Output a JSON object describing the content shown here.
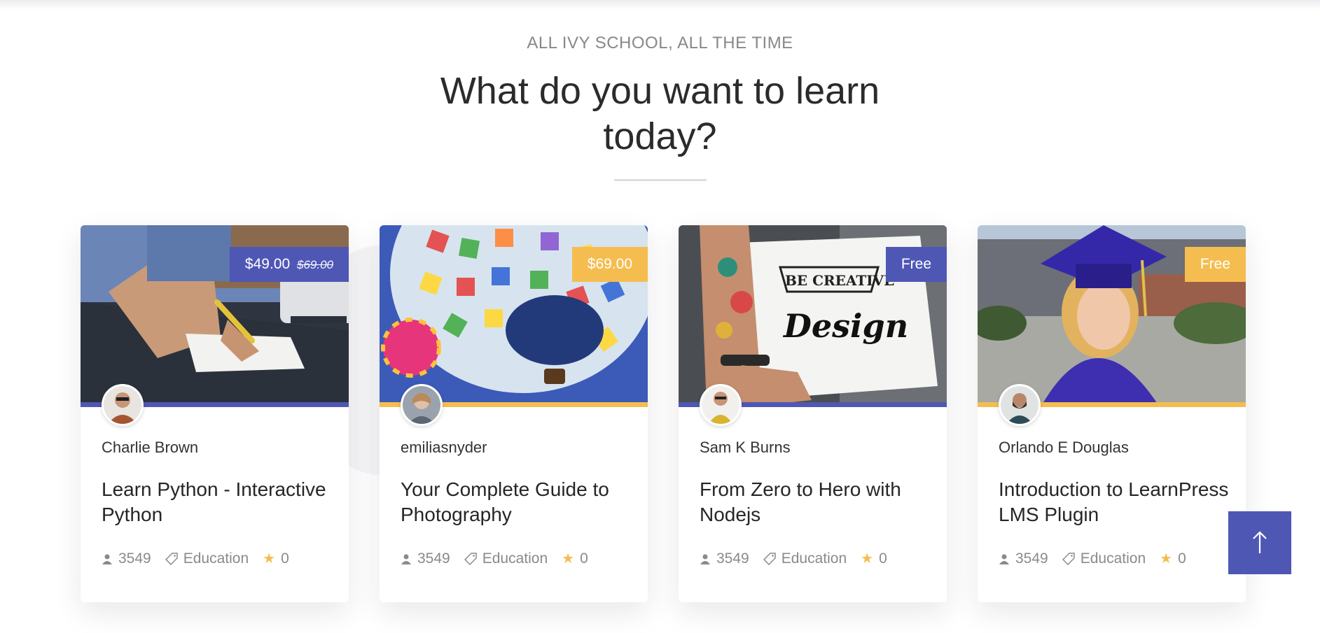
{
  "header": {
    "subtitle": "ALL IVY SCHOOL, ALL THE TIME",
    "title": "What do you want to learn today?"
  },
  "colors": {
    "primary": "#4f57b5",
    "accent": "#f5bd4f"
  },
  "courses": [
    {
      "price": "$49.00",
      "old_price": "$69.00",
      "price_color": "#4f57b5",
      "stripe_color": "#4f57b5",
      "author": "Charlie Brown",
      "title": "Learn Python - Interactive Python",
      "students": "3549",
      "category": "Education",
      "rating": "0"
    },
    {
      "price": "$69.00",
      "old_price": "",
      "price_color": "#f5bd4f",
      "stripe_color": "#f5bd4f",
      "author": "emiliasnyder",
      "title": "Your Complete Guide to Photography",
      "students": "3549",
      "category": "Education",
      "rating": "0"
    },
    {
      "price": "Free",
      "old_price": "",
      "price_color": "#4f57b5",
      "stripe_color": "#4f57b5",
      "author": "Sam K Burns",
      "title": "From Zero to Hero with Nodejs",
      "students": "3549",
      "category": "Education",
      "rating": "0"
    },
    {
      "price": "Free",
      "old_price": "",
      "price_color": "#f5bd4f",
      "stripe_color": "#f5bd4f",
      "author": "Orlando E Douglas",
      "title": "Introduction to LearnPress LMS Plugin",
      "students": "3549",
      "category": "Education",
      "rating": "0"
    }
  ],
  "images": {
    "course_1": "sketch of a hand writing on paper at a desk",
    "course_2": "sketch of a hot air balloon",
    "course_3": "sketch of a tattooed arm holding a design notebook",
    "course_4": "sketch of a graduate in cap and gown"
  },
  "scroll_top": {
    "icon": "arrow-up-icon"
  }
}
